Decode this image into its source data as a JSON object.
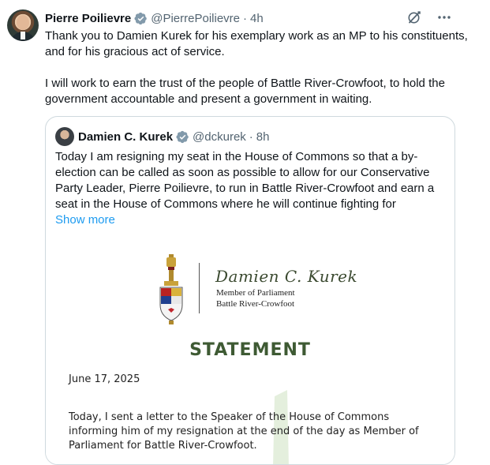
{
  "tweet": {
    "author_name": "Pierre Poilievre",
    "author_handle": "@PierrePoilievre",
    "separator": "·",
    "time": "4h",
    "paragraphs": [
      "Thank you to Damien Kurek for his exemplary work as an MP to his constituents, and for his gracious act of service.",
      "I will work to earn the trust of the people of Battle River-Crowfoot, to hold the government accountable and present a government in waiting."
    ]
  },
  "quote": {
    "author_name": "Damien C. Kurek",
    "author_handle": "@dckurek",
    "separator": "·",
    "time": "8h",
    "text": "Today I am resigning my seat in the House of Commons so that a by-election can be called as soon as possible to allow for our Conservative Party Leader, Pierre Poilievre, to run in Battle River-Crowfoot and earn a seat in the House of Commons where he will continue fighting for",
    "show_more": "Show more"
  },
  "document": {
    "signature": "Damien C. Kurek",
    "title_line": "Member of Parliament",
    "riding_line": "Battle River-Crowfoot",
    "heading": "STATEMENT",
    "date": "June 17, 2025",
    "paragraph": "Today, I sent a letter to the Speaker of the House of Commons informing him of my resignation at the end of the day as Member of Parliament for Battle River-Crowfoot."
  },
  "icons": {
    "verified": "verified-badge-icon",
    "grok": "grok-icon",
    "more": "more-options-icon"
  },
  "colors": {
    "link": "#1d9bf0",
    "muted": "#536471",
    "statement_green": "#3e5a33"
  }
}
